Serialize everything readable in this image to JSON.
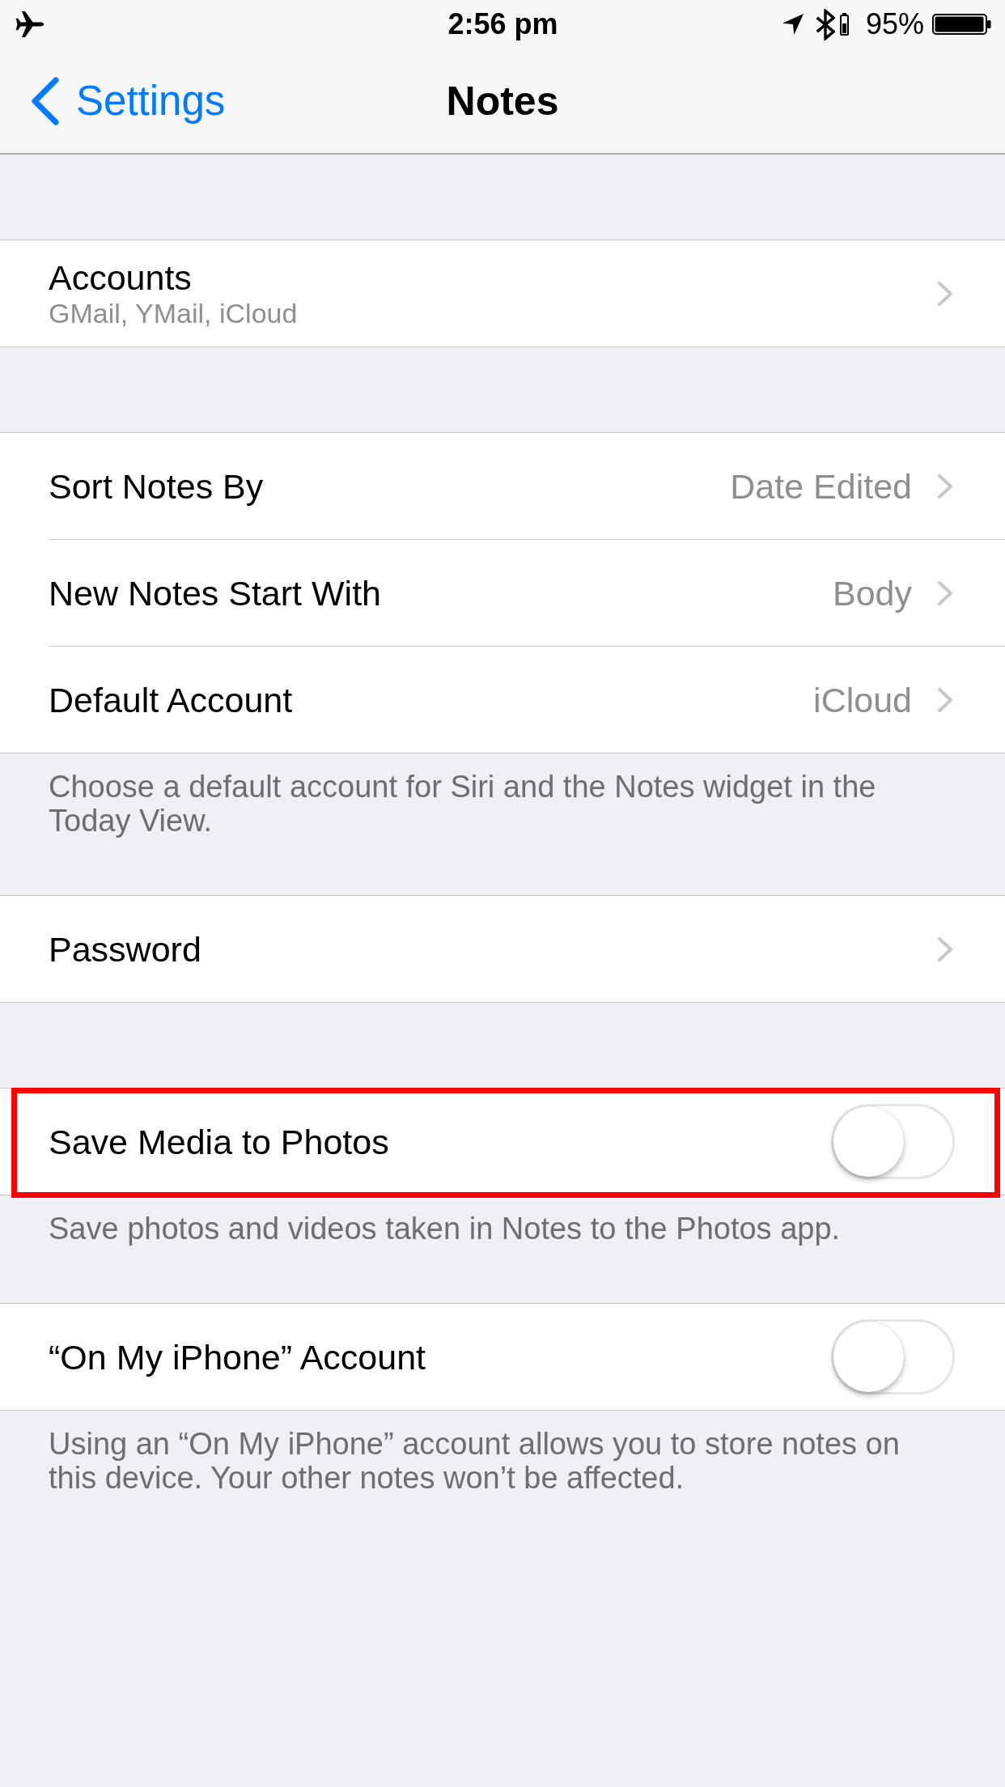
{
  "status_bar": {
    "time": "2:56 pm",
    "battery_percent": "95%"
  },
  "nav_bar": {
    "back_label": "Settings",
    "title": "Notes"
  },
  "groups": [
    {
      "rows": [
        {
          "kind": "subtitle",
          "title": "Accounts",
          "subtitle": "GMail, YMail, iCloud",
          "highlighted": false
        }
      ]
    },
    {
      "rows": [
        {
          "kind": "value",
          "title": "Sort Notes By",
          "value": "Date Edited",
          "highlighted": false
        },
        {
          "kind": "value",
          "title": "New Notes Start With",
          "value": "Body",
          "highlighted": false
        },
        {
          "kind": "value",
          "title": "Default Account",
          "value": "iCloud",
          "highlighted": false
        }
      ],
      "footer": "Choose a default account for Siri and the Notes widget in the Today View."
    },
    {
      "rows": [
        {
          "kind": "link",
          "title": "Password",
          "highlighted": false
        }
      ]
    },
    {
      "rows": [
        {
          "kind": "toggle",
          "title": "Save Media to Photos",
          "on": false,
          "highlighted": true
        }
      ],
      "footer": "Save photos and videos taken in Notes to the Photos app."
    },
    {
      "rows": [
        {
          "kind": "toggle",
          "title": "“On My iPhone” Account",
          "on": false,
          "highlighted": false
        }
      ],
      "footer": "Using an “On My iPhone” account allows you to store notes on this device. Your other notes won’t be affected."
    }
  ]
}
